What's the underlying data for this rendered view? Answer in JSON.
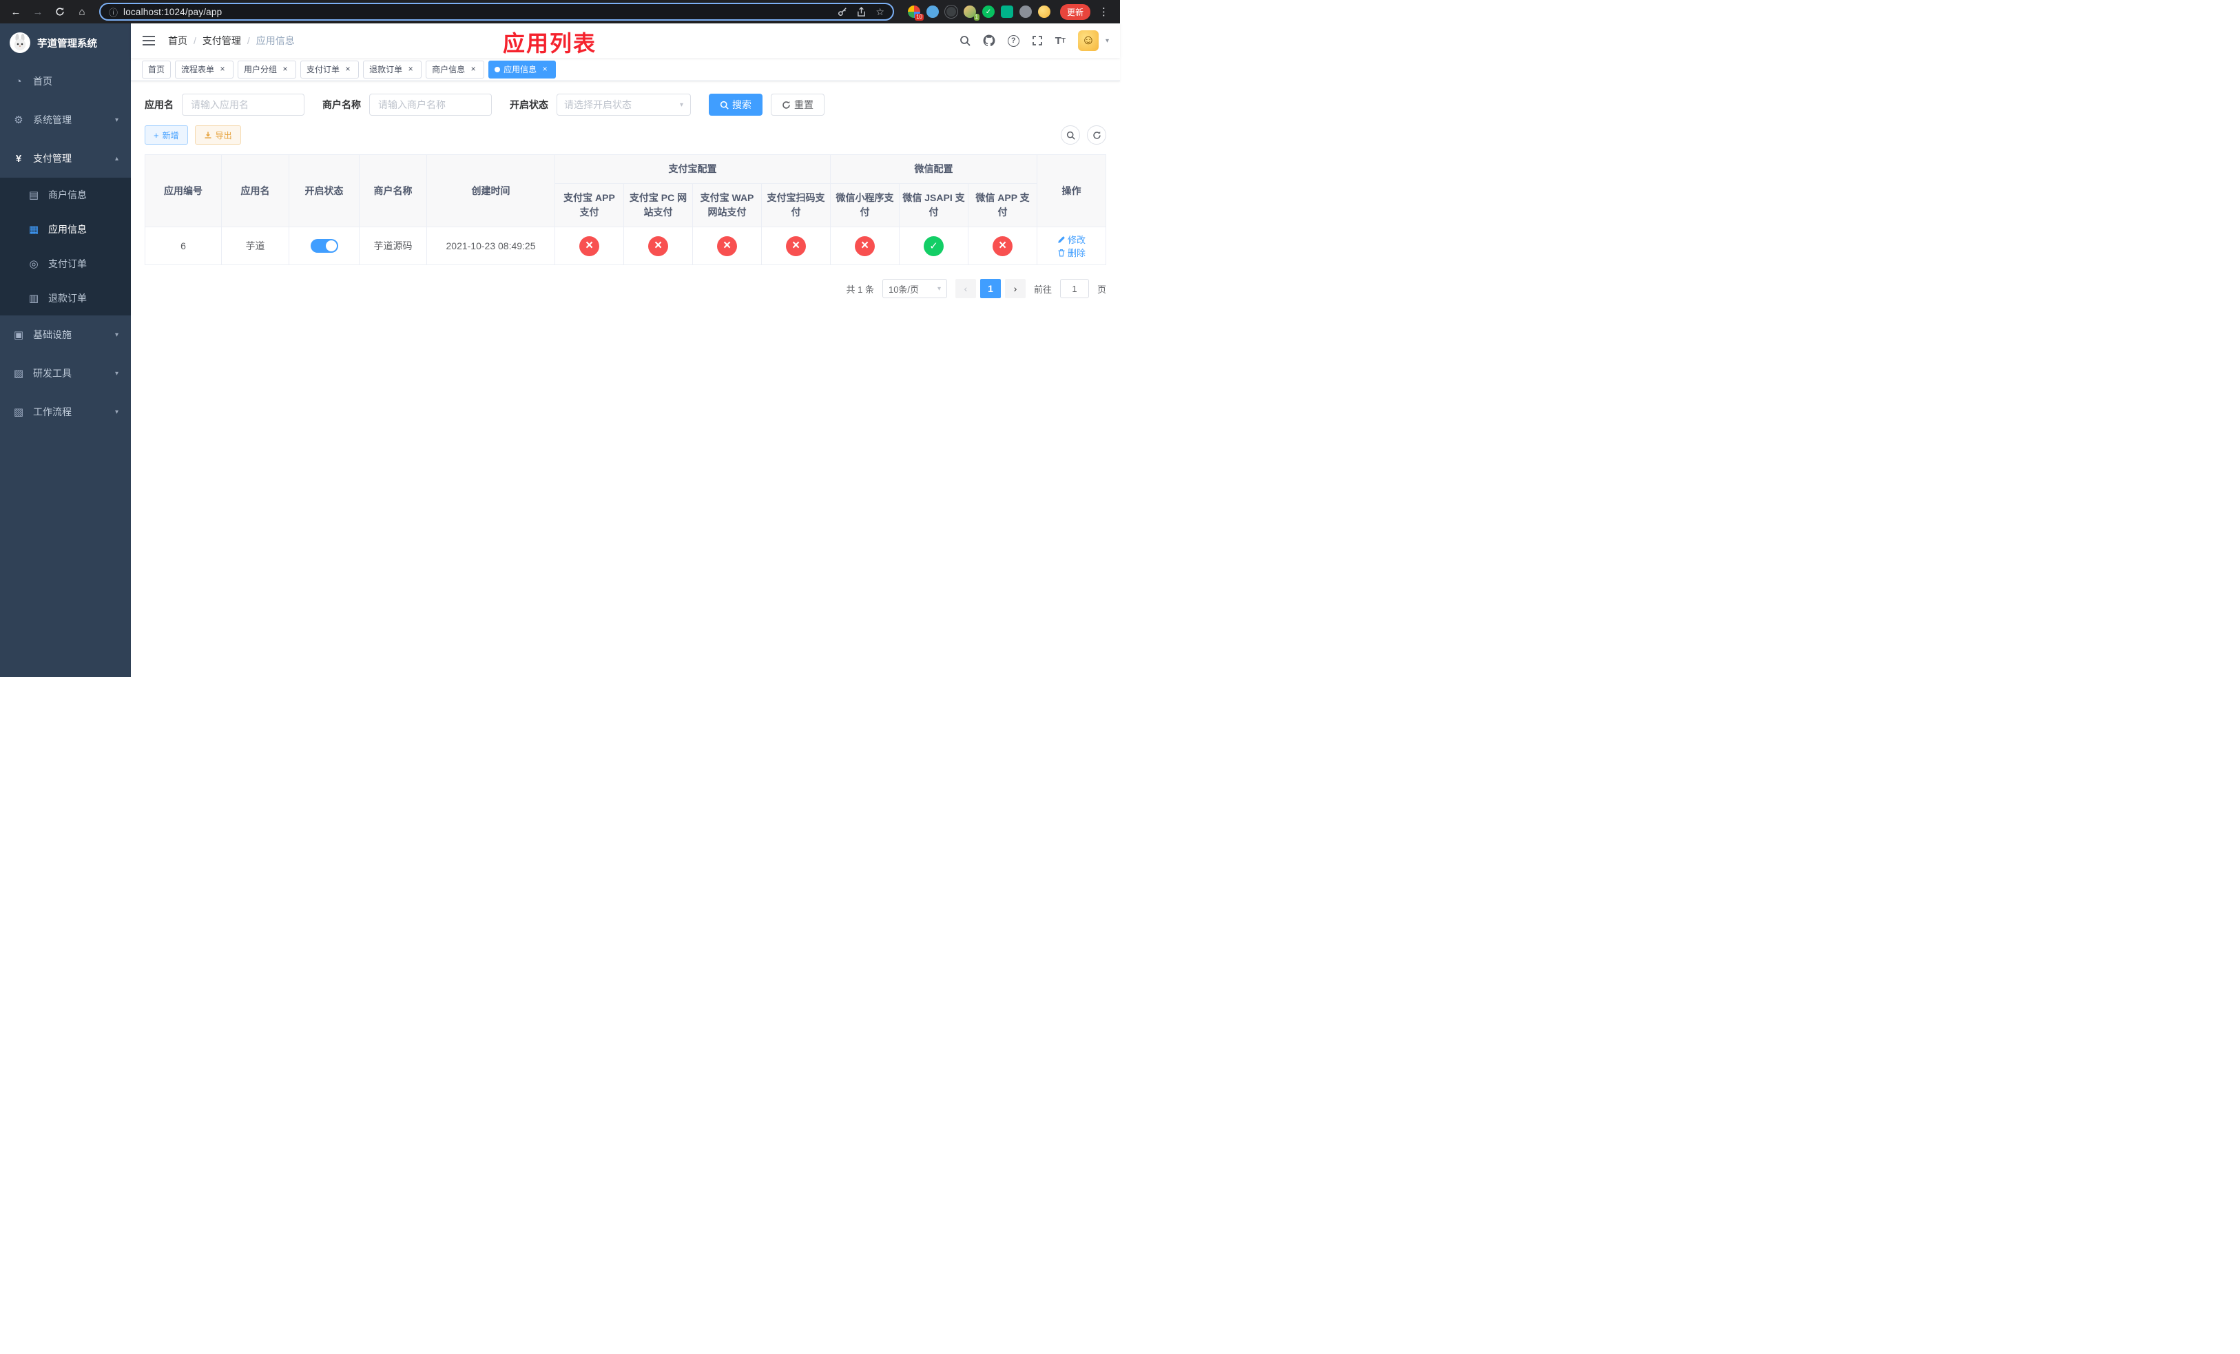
{
  "colors": {
    "primary": "#409eff",
    "danger": "#f85050",
    "success": "#13ce66",
    "warning": "#e6a23c",
    "sidebar-bg": "#304156",
    "submenu-bg": "#1f2d3d",
    "annotation": "#f5222d"
  },
  "browser": {
    "url": "localhost:1024/pay/app",
    "update_label": "更新",
    "ext_badge_red": "10",
    "ext_badge_green": "1"
  },
  "sidebar": {
    "title": "芋道管理系统",
    "items": [
      {
        "label": "首页"
      },
      {
        "label": "系统管理"
      },
      {
        "label": "支付管理",
        "children": [
          {
            "label": "商户信息"
          },
          {
            "label": "应用信息"
          },
          {
            "label": "支付订单"
          },
          {
            "label": "退款订单"
          }
        ]
      },
      {
        "label": "基础设施"
      },
      {
        "label": "研发工具"
      },
      {
        "label": "工作流程"
      }
    ]
  },
  "header": {
    "breadcrumb": [
      "首页",
      "支付管理",
      "应用信息"
    ],
    "annotation": "应用列表"
  },
  "tabs": [
    {
      "label": "首页"
    },
    {
      "label": "流程表单"
    },
    {
      "label": "用户分组"
    },
    {
      "label": "支付订单"
    },
    {
      "label": "退款订单"
    },
    {
      "label": "商户信息"
    },
    {
      "label": "应用信息"
    }
  ],
  "filters": {
    "app_name_label": "应用名",
    "app_name_placeholder": "请输入应用名",
    "merchant_label": "商户名称",
    "merchant_placeholder": "请输入商户名称",
    "status_label": "开启状态",
    "status_placeholder": "请选择开启状态",
    "search_label": "搜索",
    "reset_label": "重置"
  },
  "toolbar": {
    "add_label": "新增",
    "export_label": "导出"
  },
  "table": {
    "header": {
      "app_id": "应用编号",
      "app_name": "应用名",
      "status": "开启状态",
      "merchant": "商户名称",
      "created": "创建时间",
      "alipay_group": "支付宝配置",
      "wechat_group": "微信配置",
      "alipay_app": "支付宝 APP 支付",
      "alipay_pc": "支付宝 PC 网站支付",
      "alipay_wap": "支付宝 WAP 网站支付",
      "alipay_qr": "支付宝扫码支付",
      "wx_mini": "微信小程序支付",
      "wx_jsapi": "微信 JSAPI 支付",
      "wx_app": "微信 APP 支付",
      "actions": "操作"
    },
    "row": {
      "app_id": "6",
      "app_name": "芋道",
      "enabled": true,
      "merchant": "芋道源码",
      "created": "2021-10-23 08:49:25",
      "alipay_app": false,
      "alipay_pc": false,
      "alipay_wap": false,
      "alipay_qr": false,
      "wx_mini": false,
      "wx_jsapi": true,
      "wx_app": false,
      "edit_label": "修改",
      "delete_label": "删除"
    }
  },
  "pagination": {
    "total": "共 1 条",
    "page_size": "10条/页",
    "page": "1",
    "goto_prefix": "前往",
    "goto_value": "1",
    "goto_suffix": "页"
  }
}
